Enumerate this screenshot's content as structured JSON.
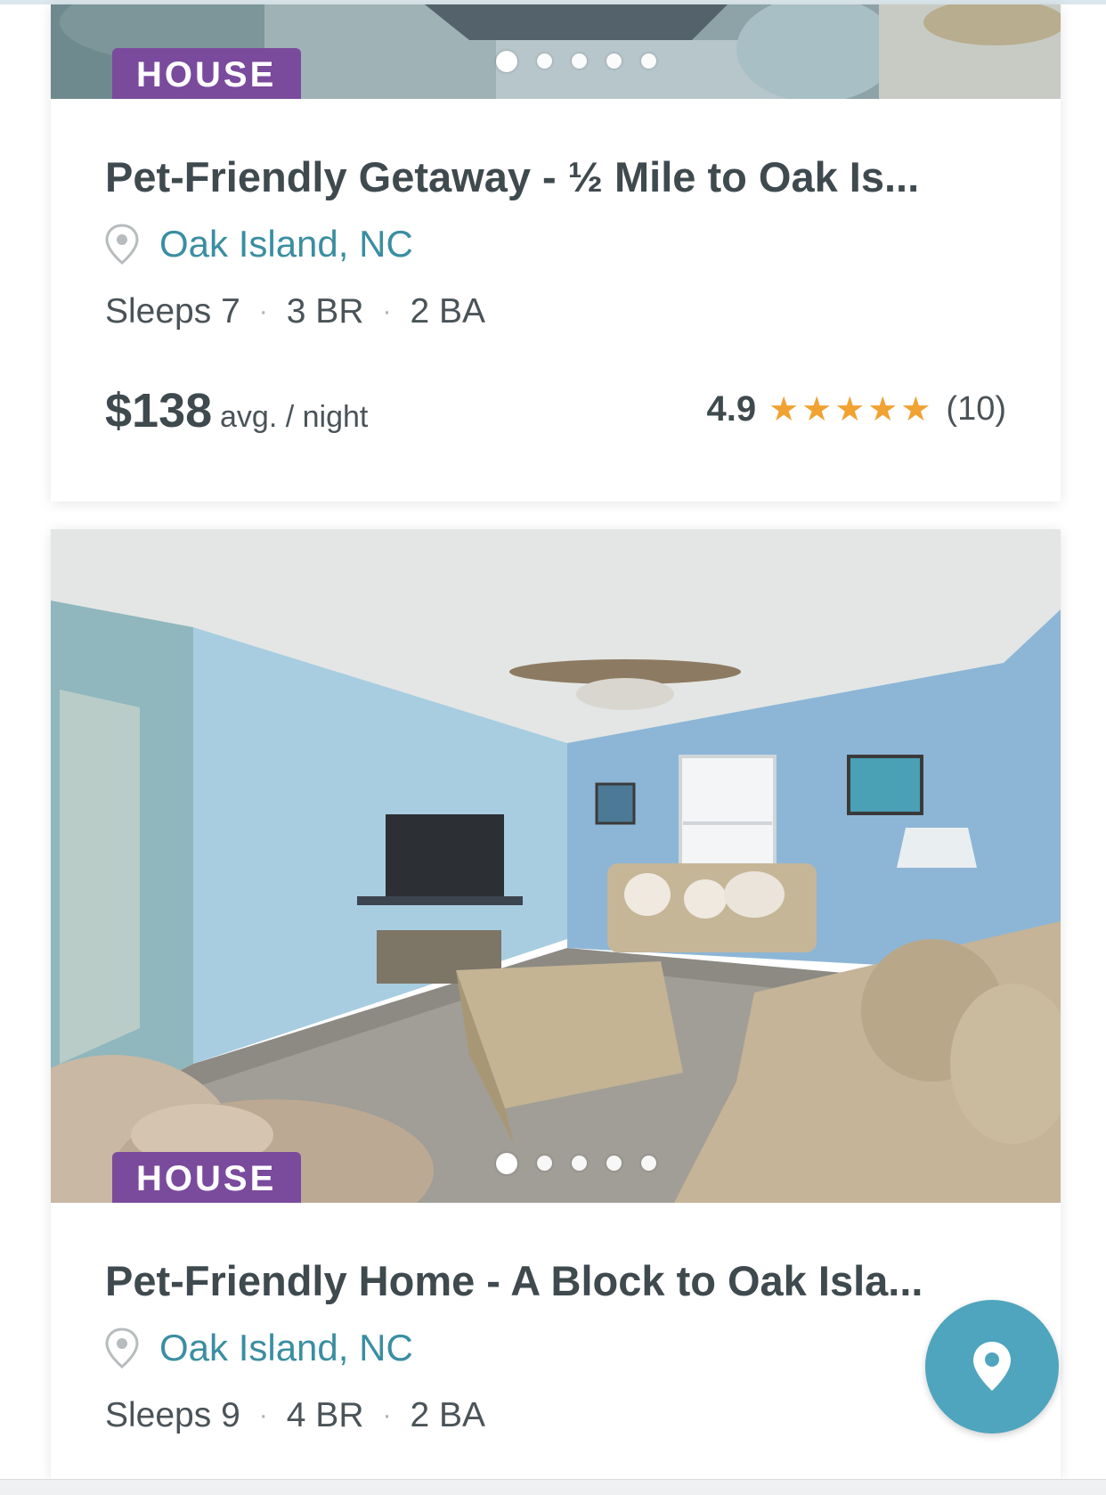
{
  "listings": [
    {
      "type_badge": "HOUSE",
      "title": "Pet-Friendly Getaway - ½ Mile to Oak Is...",
      "location": "Oak Island, NC",
      "sleeps": "Sleeps 7",
      "bedrooms": "3 BR",
      "bathrooms": "2 BA",
      "price": "$138",
      "price_unit": "avg. / night",
      "rating": "4.9",
      "stars": "★★★★★",
      "review_count": "(10)",
      "carousel": {
        "total": 5,
        "active": 1
      }
    },
    {
      "type_badge": "HOUSE",
      "title": "Pet-Friendly Home - A Block to Oak Isla...",
      "location": "Oak Island, NC",
      "sleeps": "Sleeps 9",
      "bedrooms": "4 BR",
      "bathrooms": "2 BA",
      "carousel": {
        "total": 5,
        "active": 1
      }
    }
  ],
  "separator": "·",
  "map_button": {
    "icon": "map-pin-icon"
  },
  "colors": {
    "badge": "#7a4a9c",
    "location_text": "#3b8ea1",
    "stars": "#f0a232",
    "fab": "#4ea5bd"
  }
}
